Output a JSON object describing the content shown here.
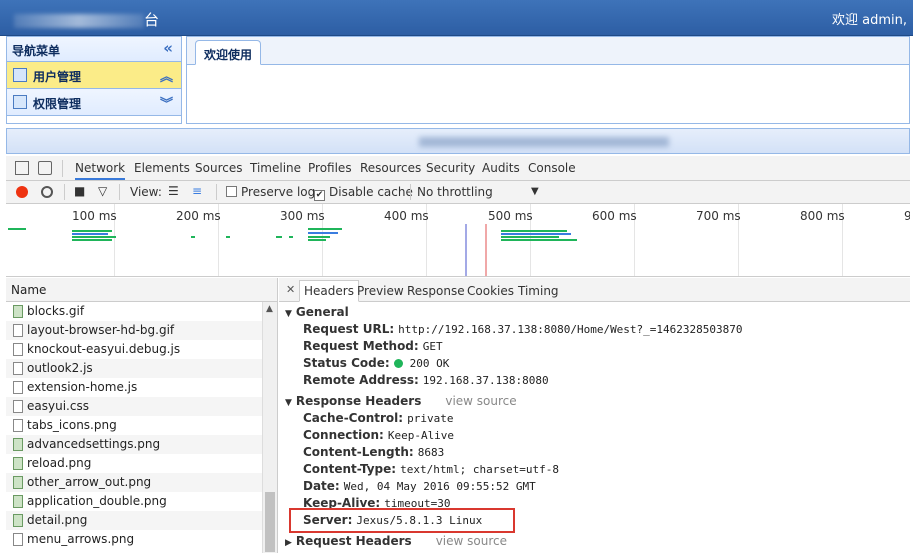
{
  "app": {
    "title_suffix": "台",
    "welcome": "欢迎 admin,"
  },
  "nav": {
    "header": "导航菜单",
    "items": [
      {
        "label": "用户管理"
      },
      {
        "label": "权限管理"
      }
    ]
  },
  "tabs": [
    {
      "label": "欢迎使用"
    }
  ],
  "devtools": {
    "tabs": [
      "Network",
      "Elements",
      "Sources",
      "Timeline",
      "Profiles",
      "Resources",
      "Security",
      "Audits",
      "Console"
    ],
    "toolbar": {
      "view_label": "View:",
      "preserve_log": "Preserve log",
      "disable_cache": "Disable cache",
      "throttling": "No throttling",
      "disable_cache_checked": true,
      "preserve_log_checked": false
    },
    "timeline_ticks": [
      "100 ms",
      "200 ms",
      "300 ms",
      "400 ms",
      "500 ms",
      "600 ms",
      "700 ms",
      "800 ms",
      "9"
    ],
    "name_header": "Name",
    "files": [
      {
        "name": "blocks.gif",
        "type": "img"
      },
      {
        "name": "layout-browser-hd-bg.gif",
        "type": "doc"
      },
      {
        "name": "knockout-easyui.debug.js",
        "type": "doc"
      },
      {
        "name": "outlook2.js",
        "type": "doc"
      },
      {
        "name": "extension-home.js",
        "type": "doc"
      },
      {
        "name": "easyui.css",
        "type": "doc"
      },
      {
        "name": "tabs_icons.png",
        "type": "doc"
      },
      {
        "name": "advancedsettings.png",
        "type": "img"
      },
      {
        "name": "reload.png",
        "type": "img"
      },
      {
        "name": "other_arrow_out.png",
        "type": "img"
      },
      {
        "name": "application_double.png",
        "type": "img"
      },
      {
        "name": "detail.png",
        "type": "img"
      },
      {
        "name": "menu_arrows.png",
        "type": "doc"
      }
    ],
    "detail_tabs": [
      "Headers",
      "Preview",
      "Response",
      "Cookies",
      "Timing"
    ],
    "general": {
      "title": "General",
      "rows": [
        {
          "k": "Request URL:",
          "v": "http://192.168.37.138:8080/Home/West?_=1462328503870"
        },
        {
          "k": "Request Method:",
          "v": "GET"
        },
        {
          "k": "Status Code:",
          "v": "200 OK"
        },
        {
          "k": "Remote Address:",
          "v": "192.168.37.138:8080"
        }
      ]
    },
    "response_headers": {
      "title": "Response Headers",
      "view_source": "view source",
      "rows": [
        {
          "k": "Cache-Control:",
          "v": "private"
        },
        {
          "k": "Connection:",
          "v": "Keep-Alive"
        },
        {
          "k": "Content-Length:",
          "v": "8683"
        },
        {
          "k": "Content-Type:",
          "v": "text/html; charset=utf-8"
        },
        {
          "k": "Date:",
          "v": "Wed, 04 May 2016 09:55:52 GMT"
        },
        {
          "k": "Keep-Alive:",
          "v": "timeout=30"
        },
        {
          "k": "Server:",
          "v": "Jexus/5.8.1.3 Linux"
        }
      ]
    },
    "request_headers": {
      "title": "Request Headers",
      "view_source": "view source"
    }
  },
  "colors": {
    "header_blue": "#3e73b9",
    "active_nav": "#fbec88",
    "highlight_red": "#d9382f",
    "status_green": "#1fb55a"
  }
}
